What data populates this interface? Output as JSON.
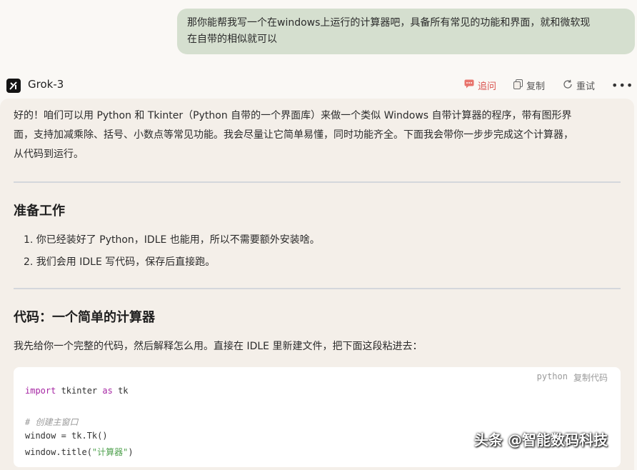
{
  "user_message": {
    "line1": "那你能帮我写一个在windows上运行的计算器吧，具备所有常见的功能和界面，就和微软现",
    "line2": "在自带的相似就可以"
  },
  "response_header": {
    "model_name": "Grok-3",
    "followup_label": "追问",
    "copy_label": "复制",
    "retry_label": "重试"
  },
  "response": {
    "intro_line1": "好的！咱们可以用 Python 和 Tkinter（Python 自带的一个界面库）来做一个类似 Windows 自带计算器的程序，带有图形界",
    "intro_line2": "面，支持加减乘除、括号、小数点等常见功能。我会尽量让它简单易懂，同时功能齐全。下面我会带你一步步完成这个计算器，",
    "intro_line3": "从代码到运行。",
    "section1_title": "准备工作",
    "section1_items": [
      "1. 你已经装好了 Python，IDLE 也能用，所以不需要额外安装啥。",
      "2. 我们会用 IDLE 写代码，保存后直接跑。"
    ],
    "section2_title": "代码：一个简单的计算器",
    "section2_intro": "我先给你一个完整的代码，然后解释怎么用。直接在 IDLE 里新建文件，把下面这段粘进去："
  },
  "code_block": {
    "language": "python",
    "copy_label": "复制代码",
    "line1_kw": "import",
    "line1_rest": " tkinter ",
    "line1_kw2": "as",
    "line1_rest2": " tk",
    "line3_comment": "# 创建主窗口",
    "line4": "window = tk.Tk()",
    "line5_pre": "window.title(",
    "line5_str": "\"计算器\"",
    "line5_post": ")"
  },
  "watermark": "头条 @智能数码科技"
}
